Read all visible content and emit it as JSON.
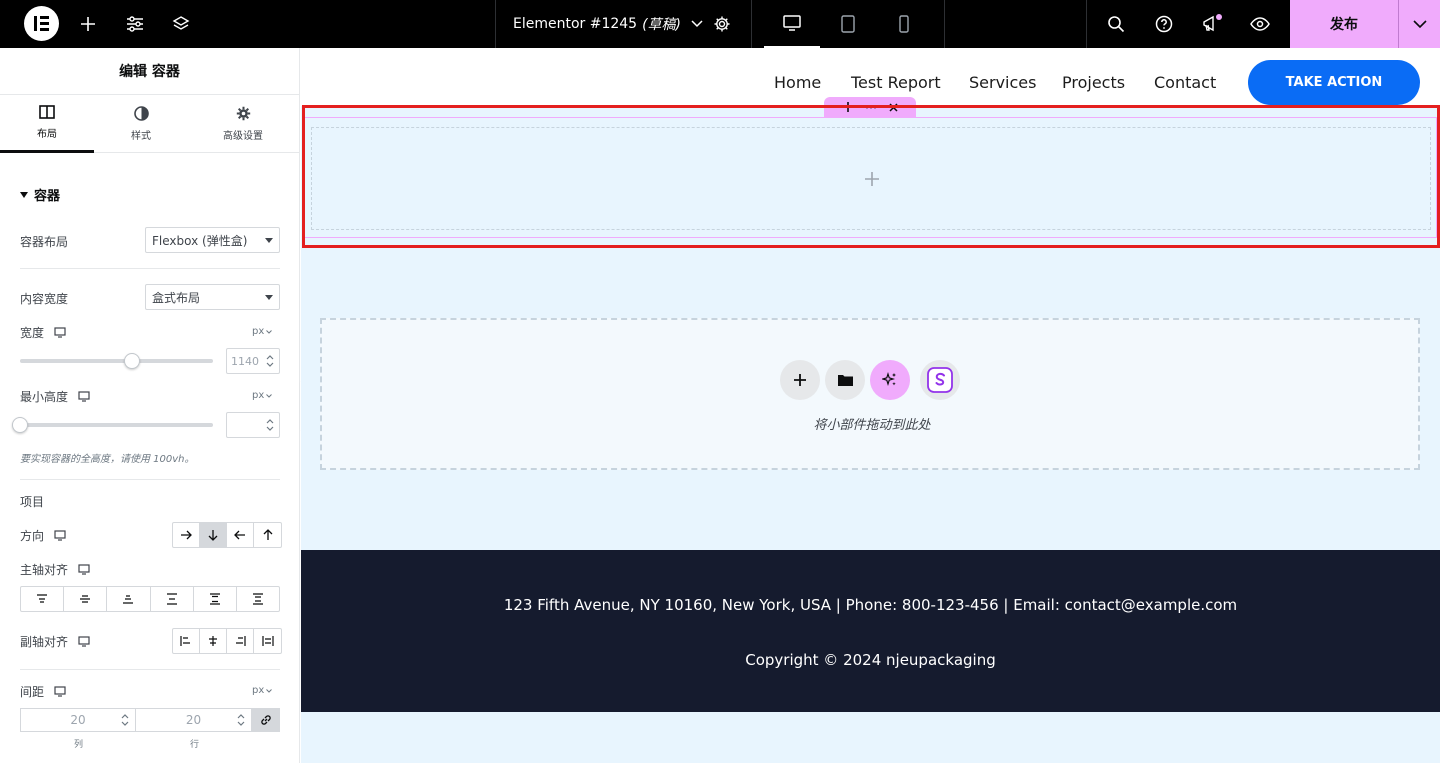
{
  "topbar": {
    "doc_name": "Elementor #1245",
    "doc_status": "(草稿)",
    "publish_label": "发布",
    "accent": "#f0abfc"
  },
  "panel": {
    "title": "编辑 容器",
    "tabs": [
      {
        "label": "布局",
        "icon": "layout-icon",
        "active": true
      },
      {
        "label": "样式",
        "icon": "half-circle-icon",
        "active": false
      },
      {
        "label": "高级设置",
        "icon": "gear-icon",
        "active": false
      }
    ],
    "section_title": "容器",
    "container_layout": {
      "label": "容器布局",
      "value": "Flexbox (弹性盒)"
    },
    "content_width": {
      "label": "内容宽度",
      "value": "盒式布局"
    },
    "width": {
      "label": "宽度",
      "unit": "px",
      "value": "1140"
    },
    "min_height": {
      "label": "最小高度",
      "unit": "px",
      "value": ""
    },
    "hint": "要实现容器的全高度，请使用 100vh。",
    "items_title": "项目",
    "direction": {
      "label": "方向"
    },
    "justify": {
      "label": "主轴对齐"
    },
    "align": {
      "label": "副轴对齐"
    },
    "gap": {
      "label": "间距",
      "unit": "px",
      "col_value": "20",
      "row_value": "20",
      "col_label": "列",
      "row_label": "行"
    }
  },
  "site": {
    "nav": [
      "Home",
      "Test Report",
      "Services",
      "Projects",
      "Contact"
    ],
    "cta": "TAKE ACTION",
    "cta_color": "#0a6cf5",
    "drop_text": "将小部件拖动到此处",
    "footer_address": "123 Fifth Avenue, NY 10160, New York, USA | Phone: 800-123-456 | Email: contact@example.com",
    "footer_copyright": "Copyright © 2024 njeupackaging",
    "footer_bg": "#151b2e"
  }
}
